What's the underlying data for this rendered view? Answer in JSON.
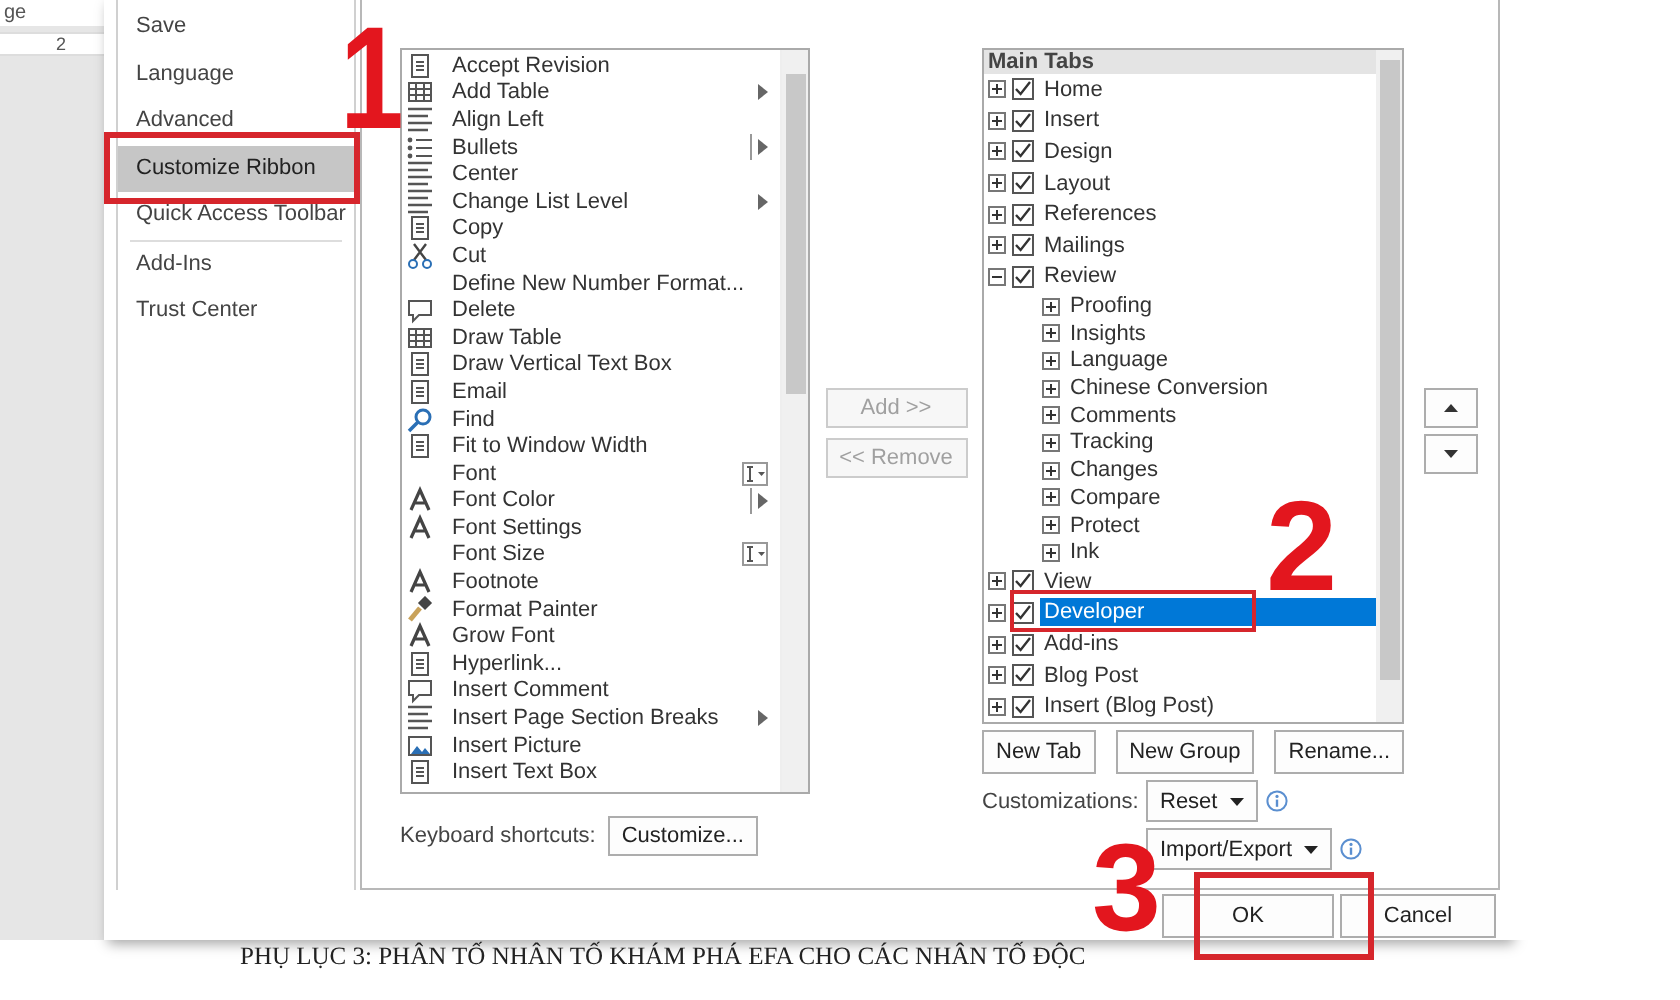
{
  "document": {
    "top_fragment": "ge",
    "ruler_number": "2",
    "heading": "PHỤ LỤC 3: PHÂN TỐ NHÂN TỐ KHÁM PHÁ EFA CHO CÁC NHÂN TỐ ĐỘC"
  },
  "sidebar": {
    "items": [
      {
        "label": "Save",
        "selected": false
      },
      {
        "label": "Language",
        "selected": false
      },
      {
        "label": "Advanced",
        "selected": false
      },
      {
        "label": "Customize Ribbon",
        "selected": true
      },
      {
        "label": "Quick Access Toolbar",
        "selected": false
      },
      {
        "label": "Add-Ins",
        "selected": false
      },
      {
        "label": "Trust Center",
        "selected": false
      }
    ]
  },
  "commands": {
    "items": [
      {
        "label": "Accept Revision",
        "kind": "plain"
      },
      {
        "label": "Add Table",
        "kind": "submenu"
      },
      {
        "label": "Align Left",
        "kind": "plain"
      },
      {
        "label": "Bullets",
        "kind": "split"
      },
      {
        "label": "Center",
        "kind": "plain"
      },
      {
        "label": "Change List Level",
        "kind": "submenu"
      },
      {
        "label": "Copy",
        "kind": "plain"
      },
      {
        "label": "Cut",
        "kind": "plain"
      },
      {
        "label": "Define New Number Format...",
        "kind": "plain"
      },
      {
        "label": "Delete",
        "kind": "plain"
      },
      {
        "label": "Draw Table",
        "kind": "plain"
      },
      {
        "label": "Draw Vertical Text Box",
        "kind": "plain"
      },
      {
        "label": "Email",
        "kind": "plain"
      },
      {
        "label": "Find",
        "kind": "plain"
      },
      {
        "label": "Fit to Window Width",
        "kind": "plain"
      },
      {
        "label": "Font",
        "kind": "combo"
      },
      {
        "label": "Font Color",
        "kind": "split"
      },
      {
        "label": "Font Settings",
        "kind": "plain"
      },
      {
        "label": "Font Size",
        "kind": "combo"
      },
      {
        "label": "Footnote",
        "kind": "plain"
      },
      {
        "label": "Format Painter",
        "kind": "plain"
      },
      {
        "label": "Grow Font",
        "kind": "plain"
      },
      {
        "label": "Hyperlink...",
        "kind": "plain"
      },
      {
        "label": "Insert Comment",
        "kind": "plain"
      },
      {
        "label": "Insert Page  Section Breaks",
        "kind": "submenu"
      },
      {
        "label": "Insert Picture",
        "kind": "plain"
      },
      {
        "label": "Insert Text Box",
        "kind": "plain"
      }
    ],
    "shortcuts_label": "Keyboard shortcuts:",
    "customize_button": "Customize..."
  },
  "transfer_buttons": [
    {
      "label": "Add >>",
      "disabled": true
    },
    {
      "label": "<< Remove",
      "disabled": true
    }
  ],
  "tabs_tree": {
    "header": "Main Tabs",
    "items": [
      {
        "label": "Home",
        "checked": true,
        "expanded": false,
        "selected": false
      },
      {
        "label": "Insert",
        "checked": true,
        "expanded": false,
        "selected": false
      },
      {
        "label": "Design",
        "checked": true,
        "expanded": false,
        "selected": false
      },
      {
        "label": "Layout",
        "checked": true,
        "expanded": false,
        "selected": false
      },
      {
        "label": "References",
        "checked": true,
        "expanded": false,
        "selected": false
      },
      {
        "label": "Mailings",
        "checked": true,
        "expanded": false,
        "selected": false
      },
      {
        "label": "Review",
        "checked": true,
        "expanded": true,
        "selected": false,
        "children": [
          {
            "label": "Proofing",
            "expanded": false,
            "selected": false
          },
          {
            "label": "Insights",
            "expanded": false,
            "selected": false
          },
          {
            "label": "Language",
            "expanded": false,
            "selected": false
          },
          {
            "label": "Chinese Conversion",
            "expanded": false,
            "selected": false
          },
          {
            "label": "Comments",
            "expanded": false,
            "selected": false
          },
          {
            "label": "Tracking",
            "expanded": false,
            "selected": false
          },
          {
            "label": "Changes",
            "expanded": false,
            "selected": false
          },
          {
            "label": "Compare",
            "expanded": false,
            "selected": false
          },
          {
            "label": "Protect",
            "expanded": false,
            "selected": false
          },
          {
            "label": "Ink",
            "expanded": false,
            "selected": false
          }
        ]
      },
      {
        "label": "View",
        "checked": true,
        "expanded": false,
        "selected": false
      },
      {
        "label": "Developer",
        "checked": true,
        "expanded": false,
        "selected": true
      },
      {
        "label": "Add-ins",
        "checked": true,
        "expanded": false,
        "selected": false
      },
      {
        "label": "Blog Post",
        "checked": true,
        "expanded": false,
        "selected": false
      },
      {
        "label": "Insert (Blog Post)",
        "checked": true,
        "expanded": false,
        "selected": false
      }
    ]
  },
  "tree_buttons": [
    "New Tab",
    "New Group",
    "Rename..."
  ],
  "customizations": {
    "label": "Customizations:",
    "reset": "Reset",
    "import_export": "Import/Export"
  },
  "dialog_buttons": [
    "OK",
    "Cancel"
  ],
  "annotations": [
    {
      "label": "1"
    },
    {
      "label": "2"
    },
    {
      "label": "3"
    }
  ]
}
